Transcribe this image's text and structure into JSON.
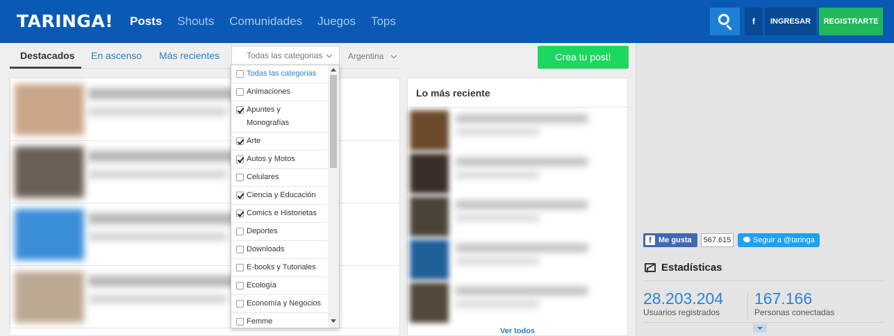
{
  "header": {
    "logo": "TARINGA!",
    "nav": [
      "Posts",
      "Shouts",
      "Comunidades",
      "Juegos",
      "Tops"
    ],
    "facebook_label": "f",
    "login_label": "INGRESAR",
    "register_label": "REGISTRARTE",
    "colors": {
      "bar": "#0a5ab5",
      "register": "#1fb85a",
      "search": "#1f7fd6"
    }
  },
  "tabs": {
    "items": [
      "Destacados",
      "En ascenso",
      "Más recientes"
    ],
    "category_select": "Todas las categorias",
    "country": "Argentina",
    "create_post": "Crea tu post!"
  },
  "dropdown": {
    "items": [
      {
        "label": "Todas las categorias",
        "checked": false,
        "highlight": true
      },
      {
        "label": "Animaciones",
        "checked": false
      },
      {
        "label": "Apuntes y Monografías",
        "checked": true
      },
      {
        "label": "Arte",
        "checked": true
      },
      {
        "label": "Autos y Motos",
        "checked": true
      },
      {
        "label": "Celulares",
        "checked": false
      },
      {
        "label": "Ciencia y Educación",
        "checked": true
      },
      {
        "label": "Comics e Historietas",
        "checked": true
      },
      {
        "label": "Deportes",
        "checked": false
      },
      {
        "label": "Downloads",
        "checked": false
      },
      {
        "label": "E-books y Tutoriales",
        "checked": false
      },
      {
        "label": "Ecología",
        "checked": false
      },
      {
        "label": "Economía y Negocios",
        "checked": false
      },
      {
        "label": "Femme",
        "checked": false
      }
    ]
  },
  "recent": {
    "title": "Lo más reciente",
    "see_all": "Ver todos"
  },
  "sidebar": {
    "like_label": "Me gusta",
    "like_count": "567.615",
    "twitter_label": "Seguir a @taringa",
    "stats_title": "Estadísticas",
    "users_count": "28.203.204",
    "users_label": "Usuarios registrados",
    "online_count": "167.166",
    "online_label": "Personas conectadas"
  }
}
